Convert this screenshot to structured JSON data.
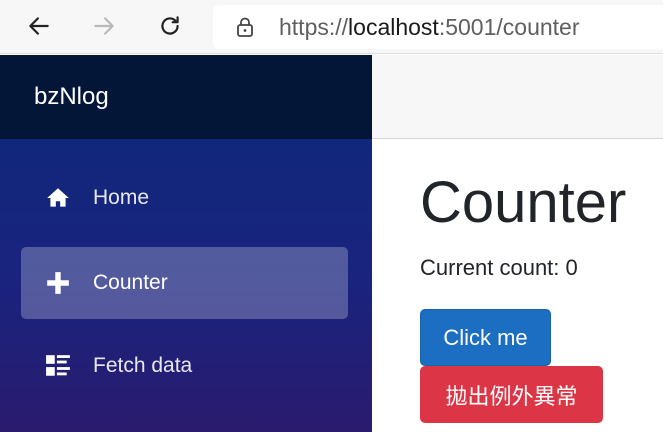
{
  "browser": {
    "url_scheme": "https://",
    "url_host": "localhost",
    "url_rest": ":5001/counter"
  },
  "icons": {
    "back": "back-arrow-icon",
    "forward": "forward-arrow-icon",
    "reload": "reload-icon",
    "lock": "lock-icon",
    "home": "home-icon",
    "counter": "plus-icon",
    "fetch": "list-rich-icon"
  },
  "sidebar": {
    "brand": "bzNlog",
    "items": [
      {
        "label": "Home",
        "active": false
      },
      {
        "label": "Counter",
        "active": true
      },
      {
        "label": "Fetch data",
        "active": false
      }
    ]
  },
  "main": {
    "title": "Counter",
    "current_count": "Current count: 0",
    "click_button": "Click me",
    "throw_button": "拋出例外異常"
  },
  "colors": {
    "primary": "#1b6ec2",
    "danger": "#dc3545",
    "sidebar_top": "#041638"
  }
}
